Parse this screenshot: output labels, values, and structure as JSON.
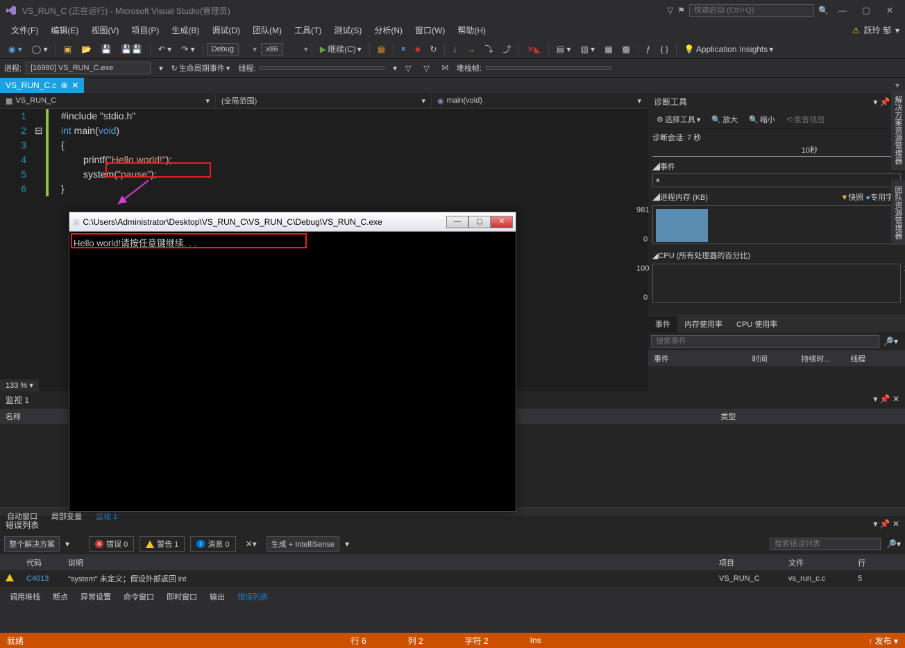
{
  "title": "VS_RUN_C (正在运行) - Microsoft Visual Studio(管理员)",
  "quick_launch_placeholder": "快速启动 (Ctrl+Q)",
  "user": "跃玲 邹",
  "menus": [
    "文件(F)",
    "编辑(E)",
    "视图(V)",
    "项目(P)",
    "生成(B)",
    "调试(D)",
    "团队(M)",
    "工具(T)",
    "测试(S)",
    "分析(N)",
    "窗口(W)",
    "帮助(H)"
  ],
  "toolbar": {
    "config": "Debug",
    "platform": "x86",
    "continue": "继续(C)",
    "insights": "Application Insights"
  },
  "debug_bar": {
    "process_lbl": "进程:",
    "process": "[16980] VS_RUN_C.exe",
    "life": "生命周期事件",
    "thread_lbl": "线程:",
    "stack_lbl": "堆栈帧:"
  },
  "tab": {
    "name": "VS_RUN_C.c"
  },
  "scopes": {
    "left": "VS_RUN_C",
    "mid": "(全局范围)",
    "right": "main(void)"
  },
  "code": {
    "l1": "#include \"stdio.h\"",
    "l2a": "int",
    "l2b": " main(",
    "l2c": "void",
    "l2d": ")",
    "l3": "{",
    "l4a": "printf(",
    "l4b": "\"Hello world!\"",
    "l4c": ");",
    "l5a": "system(",
    "l5b": "\"pause\"",
    "l5c": ");",
    "l6": "}"
  },
  "zoom": "133 %",
  "diag": {
    "title": "诊断工具",
    "select": "选择工具",
    "zoom_in": "放大",
    "zoom_out": "缩小",
    "reset": "重置视图",
    "session": "诊断会话: 7 秒",
    "timeline": "10秒",
    "events": "事件",
    "mem_hdr": "进程内存 (KB)",
    "snapshot": "快照",
    "private": "专用字节",
    "mem_max": "981",
    "mem_min": "0",
    "cpu_hdr": "CPU (所有处理器的百分比)",
    "cpu_max": "100",
    "cpu_min": "0",
    "tabs": [
      "事件",
      "内存使用率",
      "CPU 使用率"
    ],
    "search_ph": "搜索事件",
    "cols": [
      "事件",
      "时间",
      "持续时...",
      "线程"
    ]
  },
  "watch": {
    "title": "监视 1",
    "cols": [
      "名称",
      "类型"
    ],
    "tabs": [
      "自动窗口",
      "局部变量",
      "监视 1"
    ]
  },
  "err": {
    "title": "错误列表",
    "scope": "整个解决方案",
    "errors": "错误 0",
    "warnings": "警告 1",
    "msgs": "消息 0",
    "filter": "生成 + IntelliSense",
    "search_ph": "搜索错误列表",
    "cols": [
      "",
      "代码",
      "说明",
      "项目",
      "文件",
      "行"
    ],
    "row": {
      "code": "C4013",
      "desc": "\"system\" 未定义；假设外部返回 int",
      "proj": "VS_RUN_C",
      "file": "vs_run_c.c",
      "line": "5"
    }
  },
  "bottom_tabs": [
    "调用堆栈",
    "断点",
    "异常设置",
    "命令窗口",
    "即时窗口",
    "输出",
    "错误列表"
  ],
  "status": {
    "ready": "就绪",
    "line": "行 6",
    "col": "列 2",
    "char": "字符 2",
    "ins": "Ins",
    "publish": "发布"
  },
  "side_tabs": [
    "解决方案资源管理器",
    "团队资源管理器"
  ],
  "console": {
    "title": "C:\\Users\\Administrator\\Desktop\\VS_RUN_C\\VS_RUN_C\\Debug\\VS_RUN_C.exe",
    "output": "Hello world!请按任意键继续. . . _"
  }
}
